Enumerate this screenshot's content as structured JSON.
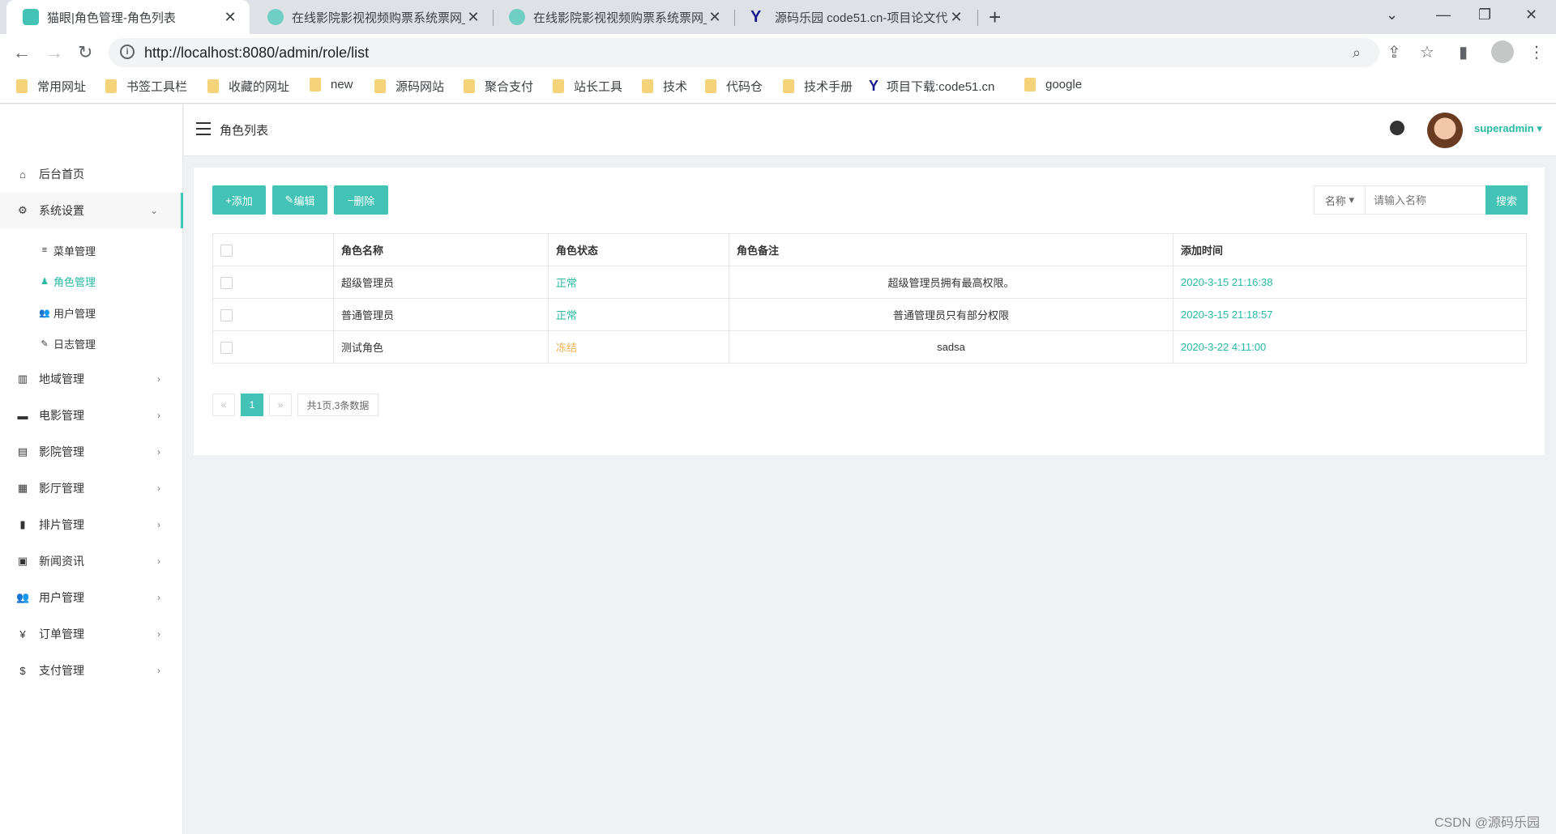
{
  "browser": {
    "tabs": [
      {
        "title": "猫眼|角色管理-角色列表",
        "active": true
      },
      {
        "title": "在线影院影视视频购票系统票网_",
        "active": false
      },
      {
        "title": "在线影院影视视频购票系统票网_",
        "active": false
      },
      {
        "title": "源码乐园 code51.cn-项目论文代",
        "active": false
      }
    ],
    "url": "http://localhost:8080/admin/role/list",
    "bookmarks": [
      "常用网址",
      "书签工具栏",
      "收藏的网址",
      "new",
      "源码网站",
      "聚合支付",
      "站长工具",
      "技术",
      "代码仓",
      "技术手册",
      "项目下载:code51.cn",
      "google"
    ]
  },
  "sidebar": {
    "items": [
      {
        "label": "后台首页",
        "icon": "home-icon"
      },
      {
        "label": "系统设置",
        "icon": "gear-icon"
      },
      {
        "label": "地域管理",
        "icon": "map-icon"
      },
      {
        "label": "电影管理",
        "icon": "film-icon"
      },
      {
        "label": "影院管理",
        "icon": "cinema-icon"
      },
      {
        "label": "影厅管理",
        "icon": "hall-icon"
      },
      {
        "label": "排片管理",
        "icon": "schedule-icon"
      },
      {
        "label": "新闻资讯",
        "icon": "news-icon"
      },
      {
        "label": "用户管理",
        "icon": "users-icon"
      },
      {
        "label": "订单管理",
        "icon": "yen-icon"
      },
      {
        "label": "支付管理",
        "icon": "dollar-icon"
      }
    ],
    "sub_items": [
      {
        "label": "菜单管理",
        "icon": "list-icon"
      },
      {
        "label": "角色管理",
        "icon": "role-icon",
        "active": true
      },
      {
        "label": "用户管理",
        "icon": "users-icon"
      },
      {
        "label": "日志管理",
        "icon": "tag-icon"
      }
    ]
  },
  "header": {
    "breadcrumb": "角色列表",
    "username": "superadmin"
  },
  "toolbar": {
    "add": "添加",
    "edit": "编辑",
    "delete": "删除",
    "search_field": "名称",
    "search_placeholder": "请输入名称",
    "search_button": "搜索"
  },
  "table": {
    "columns": [
      "角色名称",
      "角色状态",
      "角色备注",
      "添加时间"
    ],
    "rows": [
      {
        "name": "超级管理员",
        "status": "正常",
        "remark": "超级管理员拥有最高权限。",
        "time": "2020-3-15 21:16:38"
      },
      {
        "name": "普通管理员",
        "status": "正常",
        "remark": "普通管理员只有部分权限",
        "time": "2020-3-15 21:18:57"
      },
      {
        "name": "测试角色",
        "status": "冻结",
        "remark": "sadsa",
        "time": "2020-3-22 4:11:00"
      }
    ]
  },
  "pagination": {
    "prev": "«",
    "current": "1",
    "next": "»",
    "summary": "共1页,3条数据"
  },
  "watermark": "CSDN @源码乐园",
  "colors": {
    "accent": "#42c3b6",
    "text_accent": "#26b9a5",
    "frozen": "#f0ad4e"
  }
}
